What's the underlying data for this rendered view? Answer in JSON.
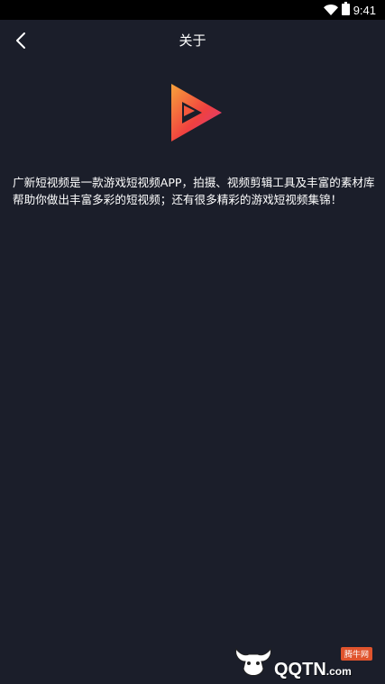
{
  "status_bar": {
    "time": "9:41",
    "icons": [
      "wifi-icon",
      "battery-icon"
    ]
  },
  "header": {
    "title": "关于",
    "back_icon": "chevron-left-icon"
  },
  "logo": {
    "icon": "play-triangle-logo",
    "colors": [
      "#f7a23b",
      "#f0413f",
      "#d63a8a"
    ]
  },
  "about": {
    "description": "广新短视频是一款游戏短视频APP，拍摄、视频剪辑工具及丰富的素材库帮助你做出丰富多彩的短视频；还有很多精彩的游戏短视频集锦！"
  },
  "watermark": {
    "badge": "腾牛网",
    "brand": "QQTN",
    "domain": ".com"
  },
  "colors": {
    "background": "#1b1e2a",
    "status_bar": "#000000",
    "text": "#ffffff"
  }
}
